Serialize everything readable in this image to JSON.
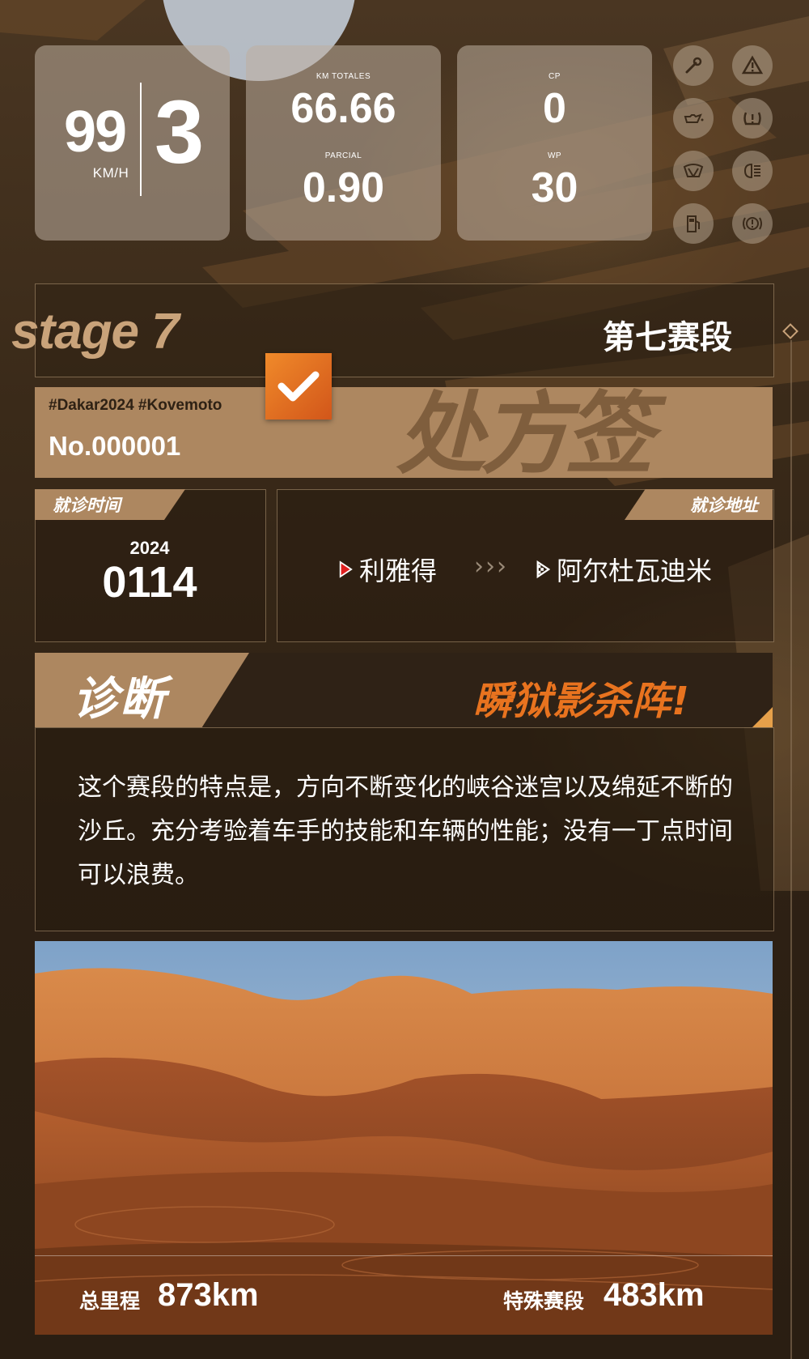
{
  "dashboard": {
    "speed": "99",
    "speed_unit": "KM/H",
    "gear": "3",
    "km_totales_label": "KM TOTALES",
    "km_totales": "66.66",
    "parcial_label": "PARCIAL",
    "parcial": "0.90",
    "cp_label": "CP",
    "cp": "0",
    "wp_label": "WP",
    "wp": "30",
    "indicators": [
      "wrench-icon",
      "warning-triangle-icon",
      "oil-can-icon",
      "tire-pressure-icon",
      "wiper-icon",
      "headlight-icon",
      "fuel-pump-icon",
      "brake-warning-icon"
    ]
  },
  "stage": {
    "title": "stage 7",
    "title_cn": "第七赛段"
  },
  "prescription": {
    "tags": "#Dakar2024 #Kovemoto",
    "number": "No.000001",
    "watermark": "处方签"
  },
  "visit_time": {
    "label": "就诊时间",
    "year": "2024",
    "date": "0114"
  },
  "visit_location": {
    "label": "就诊地址",
    "from": "利雅得",
    "arrows": "›››",
    "to": "阿尔杜瓦迪米"
  },
  "diagnosis": {
    "label": "诊断",
    "slogan": "瞬狱影杀阵!",
    "text": "这个赛段的特点是，方向不断变化的峡谷迷宫以及绵延不断的沙丘。充分考验着车手的技能和车辆的性能；没有一丁点时间可以浪费。"
  },
  "stats": {
    "total_label": "总里程",
    "total_value": "873km",
    "special_label": "特殊赛段",
    "special_value": "483km"
  },
  "colors": {
    "accent_orange": "#e8731f",
    "tan": "#ad8760",
    "panel": "#bcae9f"
  }
}
